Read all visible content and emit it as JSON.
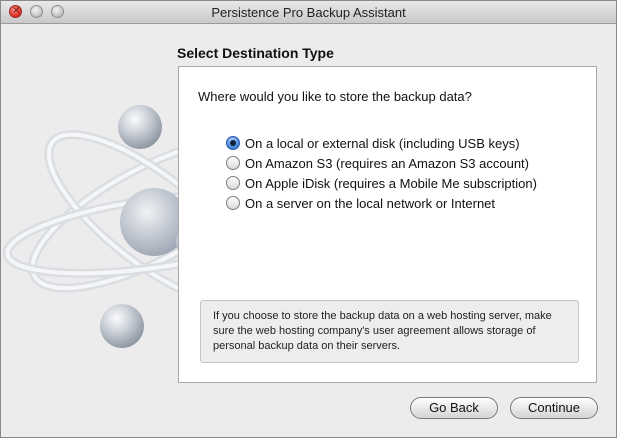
{
  "window": {
    "title": "Persistence Pro Backup Assistant"
  },
  "heading": "Select Destination Type",
  "question": "Where would you like to store the backup data?",
  "options": [
    {
      "label": "On a local or external disk (including USB keys)",
      "selected": true
    },
    {
      "label": "On Amazon S3 (requires an Amazon S3 account)",
      "selected": false
    },
    {
      "label": "On Apple iDisk (requires a Mobile Me subscription)",
      "selected": false
    },
    {
      "label": "On a server on the local network or Internet",
      "selected": false
    }
  ],
  "note": "If you choose to store the backup data on a web hosting server, make sure the web hosting company's user agreement allows storage of personal backup data on their servers.",
  "buttons": {
    "back": "Go Back",
    "continue": "Continue"
  },
  "icons": {
    "close": "close-icon",
    "minimize": "minimize-icon",
    "zoom": "zoom-icon",
    "logo": "atom-logo-icon"
  }
}
